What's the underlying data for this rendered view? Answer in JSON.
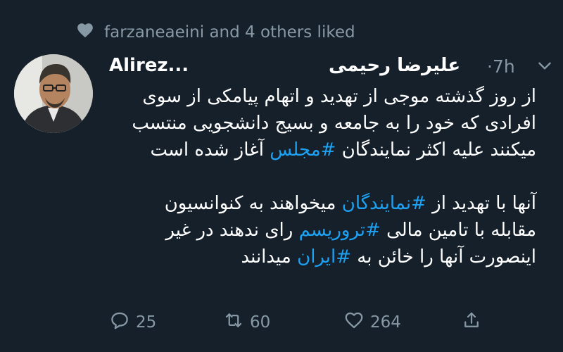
{
  "social_context": {
    "text": "farzaneaeini and 4 others liked",
    "icon": "heart-icon"
  },
  "tweet": {
    "username": "Alirez...",
    "display_name": "علیرضا رحیمی",
    "time": "·7h",
    "menu_icon": "chevron-down-icon",
    "paragraph1": {
      "line1": "از روز گذشته موجی از تهدید و اتهام پیامکی از سوی",
      "line2": "افرادی که خود را به جامعه و بسیج دانشجویی منتسب",
      "line3_a": "میکنند علیه اکثر نمایندگان ",
      "hashtag1": "#مجلس",
      "line3_b": " آغاز شده است"
    },
    "paragraph2": {
      "line1_a": "آنها با تهدید از ",
      "hashtag2": "#نمایندگان",
      "line1_b": " میخواهند به کنوانسیون",
      "line2_a": "مقابله با تامین مالی ",
      "hashtag3": "#تروریسم",
      "line2_b": " رای ندهند در غیر",
      "line3_a": "اینصورت آنها را خائن به ",
      "hashtag4": "#ایران",
      "line3_b": " میدانند"
    }
  },
  "actions": {
    "reply_count": "25",
    "retweet_count": "60",
    "like_count": "264"
  },
  "colors": {
    "background": "#15202b",
    "text": "#ffffff",
    "secondary": "#8899a6",
    "link": "#1da1f2"
  }
}
